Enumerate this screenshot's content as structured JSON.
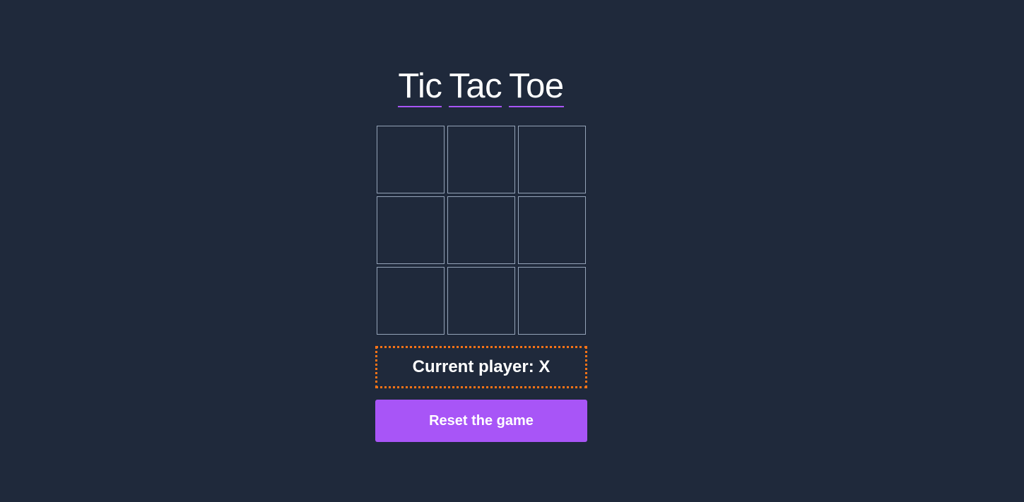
{
  "title": {
    "words": [
      "Tic",
      "Tac",
      "Toe"
    ]
  },
  "board": {
    "cells": [
      "",
      "",
      "",
      "",
      "",
      "",
      "",
      "",
      ""
    ]
  },
  "status": {
    "text": "Current player: X",
    "current_player": "X"
  },
  "reset_button": {
    "label": "Reset the game"
  },
  "colors": {
    "background": "#1f293b",
    "accent": "#a855f7",
    "status_border": "#f97316",
    "cell_border": "#94a3b8",
    "text": "#ffffff"
  }
}
